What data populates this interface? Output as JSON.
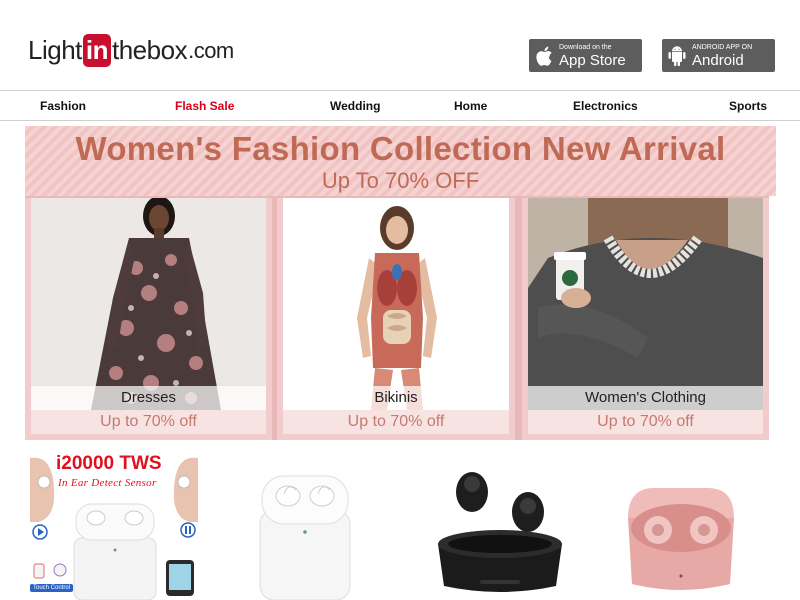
{
  "header": {
    "logo": {
      "pre": "Light",
      "highlight": "in",
      "post": "thebox",
      "suffix": ".com"
    },
    "app_store": {
      "small": "Download on the",
      "big": "App Store",
      "icon": "apple-icon"
    },
    "android": {
      "small": "ANDROID APP ON",
      "big": "Android",
      "icon": "android-icon"
    }
  },
  "nav": {
    "items": [
      {
        "label": "Fashion"
      },
      {
        "label": "Flash Sale",
        "color": "#d7001b"
      },
      {
        "label": "Wedding"
      },
      {
        "label": "Home"
      },
      {
        "label": "Electronics"
      },
      {
        "label": "Sports"
      }
    ]
  },
  "banner": {
    "title": "Women's Fashion Collection New Arrival",
    "subtitle": "Up To 70% OFF",
    "cards": [
      {
        "name": "Dresses",
        "offer": "Up to 70% off"
      },
      {
        "name": "Bikinis",
        "offer": "Up to 70% off"
      },
      {
        "name": "Women's Clothing",
        "offer": "Up to 70% off"
      }
    ]
  },
  "products": {
    "p1": {
      "title": "i20000 TWS",
      "subtitle": "In Ear Detect Sensor",
      "touch_label": "Touch Control"
    }
  },
  "colors": {
    "brand_red": "#c8102e",
    "flash_red": "#d7001b",
    "banner_pink": "#e9b9b9",
    "banner_text": "#c06a55"
  }
}
